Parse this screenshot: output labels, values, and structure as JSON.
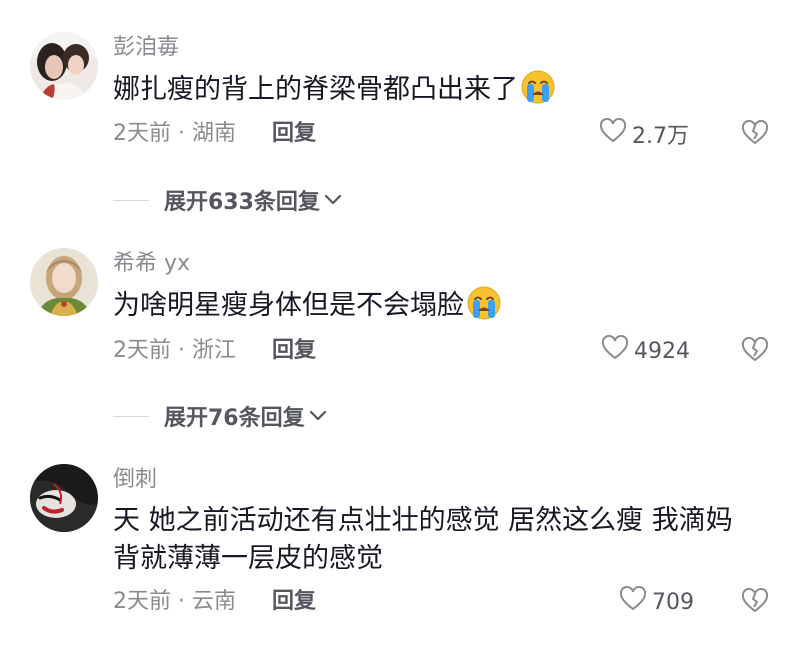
{
  "comments": [
    {
      "username": "彭洎毐",
      "text": "娜扎瘦的背上的脊梁骨都凸出来了",
      "emoji": "crying-face-icon",
      "time_location": "2天前 · 湖南",
      "reply_label": "回复",
      "likes": "2.7万",
      "expand_label": "展开633条回复"
    },
    {
      "username": "希希 yx",
      "text": "为啥明星瘦身体但是不会塌脸",
      "emoji": "crying-face-icon",
      "time_location": "2天前 · 浙江",
      "reply_label": "回复",
      "likes": "4924",
      "expand_label": "展开76条回复"
    },
    {
      "username": "倒刺",
      "text_line1": "天 她之前活动还有点壮壮的感觉 居然这么瘦 我滴妈",
      "text_line2": "背就薄薄一层皮的感觉",
      "time_location": "2天前 · 云南",
      "reply_label": "回复",
      "likes": "709"
    }
  ],
  "colors": {
    "text": "#161823",
    "secondary": "#8a8b91",
    "action": "#55575e",
    "emoji_face": "#f7c12f",
    "emoji_tear": "#3aa0f3"
  }
}
